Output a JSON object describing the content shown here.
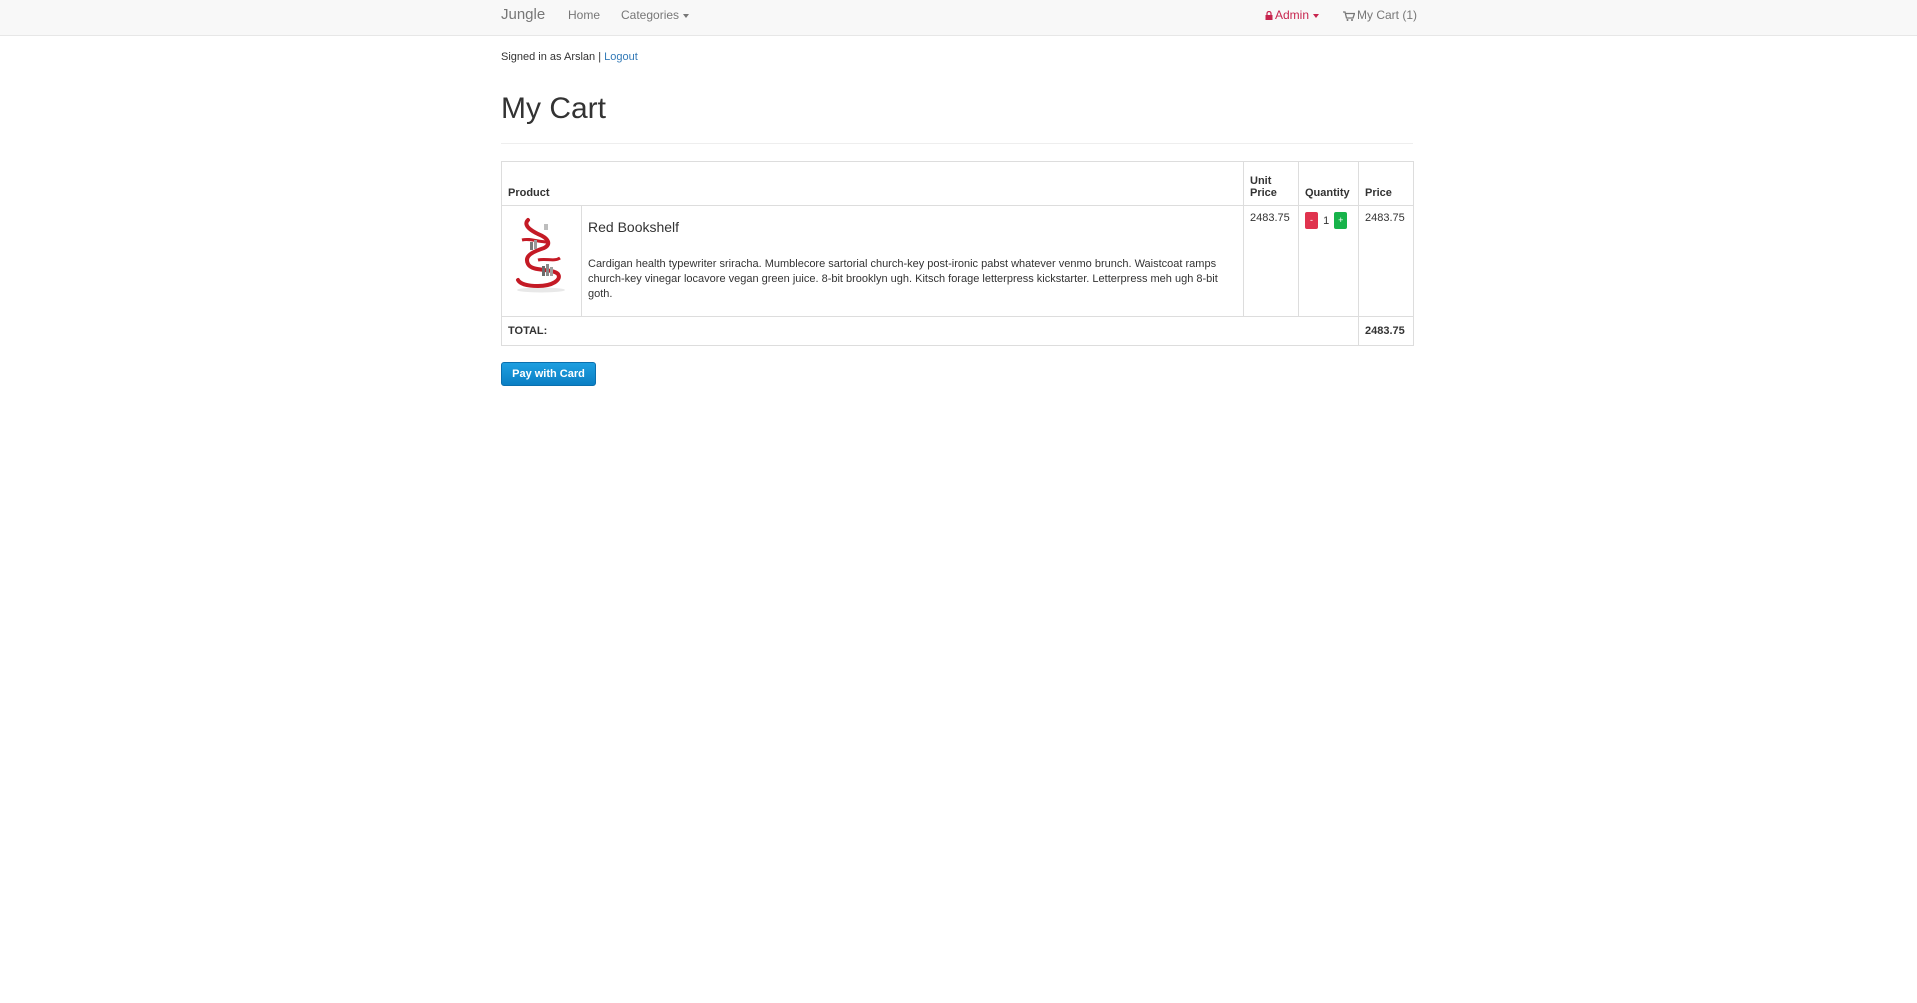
{
  "navbar": {
    "brand": "Jungle",
    "home": "Home",
    "categories": "Categories",
    "admin": "Admin",
    "cart": "My Cart (1)"
  },
  "session": {
    "signed_in_text": "Signed in as Arslan |",
    "logout": "Logout"
  },
  "page": {
    "title": "My Cart"
  },
  "table": {
    "headers": {
      "product": "Product",
      "unit_price": "Unit Price",
      "quantity": "Quantity",
      "price": "Price"
    },
    "items": [
      {
        "name": "Red Bookshelf",
        "description": "Cardigan health typewriter sriracha. Mumblecore sartorial church-key post-ironic pabst whatever venmo brunch. Waistcoat ramps church-key vinegar locavore vegan green juice. 8-bit brooklyn ugh. Kitsch forage letterpress kickstarter. Letterpress meh ugh 8-bit goth.",
        "unit_price": "2483.75",
        "quantity": "1",
        "decrement": "-",
        "increment": "+",
        "price": "2483.75"
      }
    ],
    "total_label": "TOTAL:",
    "total_value": "2483.75"
  },
  "checkout": {
    "pay_button": "Pay with Card"
  },
  "colors": {
    "admin": "#c7254e",
    "link": "#337ab7",
    "minus": "#e0334e",
    "plus": "#17b34a",
    "pay": "#0a7fc4"
  }
}
